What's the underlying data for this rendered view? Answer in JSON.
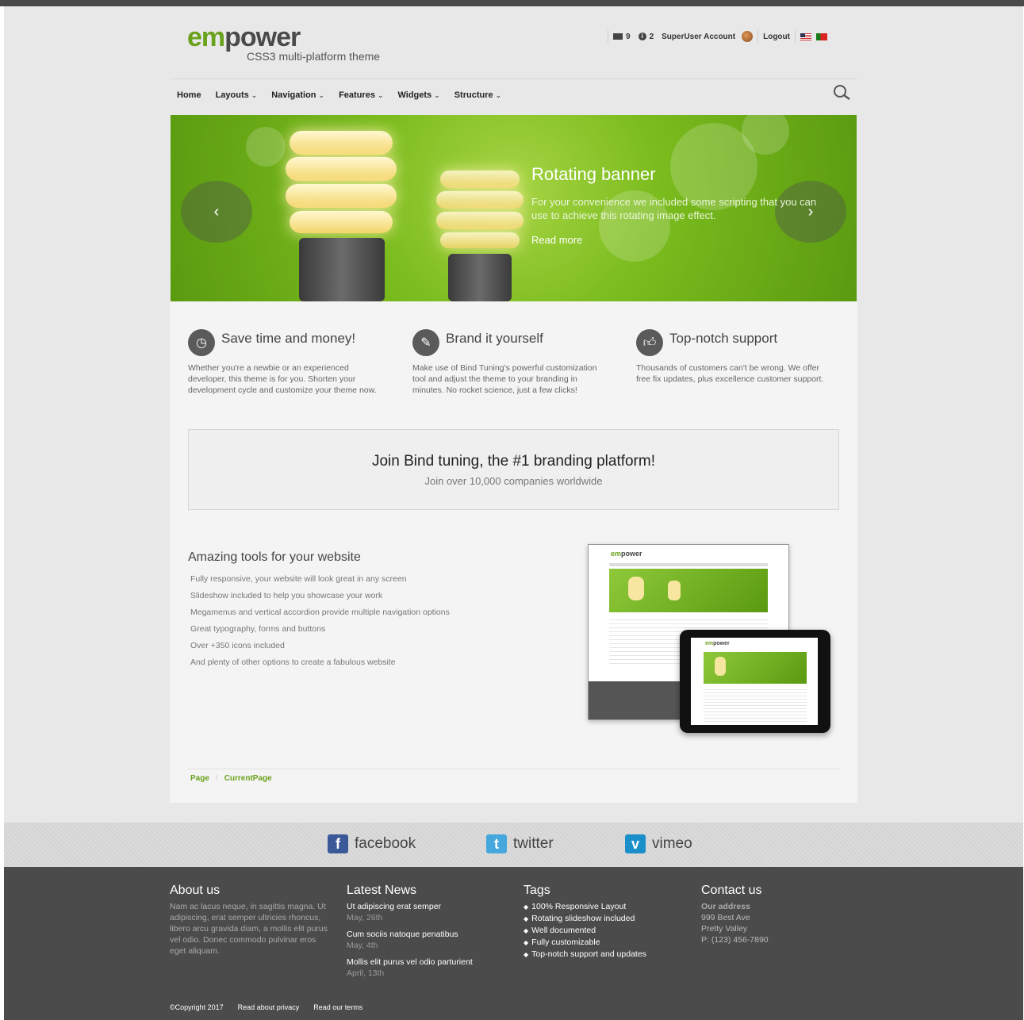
{
  "logo": {
    "part1": "em",
    "part2": "power",
    "tagline": "CSS3 multi-platform theme"
  },
  "userbar": {
    "messages_count": "9",
    "notifications_count": "2",
    "account": "SuperUser Account",
    "logout": "Logout"
  },
  "nav": {
    "items": [
      "Home",
      "Layouts",
      "Navigation",
      "Features",
      "Widgets",
      "Structure"
    ]
  },
  "banner": {
    "title": "Rotating banner",
    "text": "For your convenience we included some scripting that you can use to achieve this rotating image effect.",
    "link": "Read more",
    "prev": "‹",
    "next": "›"
  },
  "features": [
    {
      "icon": "clock-icon",
      "title": "Save time and money!",
      "text": "Whether you're a newbie or an experienced developer, this theme is for you. Shorten your development cycle and customize your theme now."
    },
    {
      "icon": "magic-wand-icon",
      "title": "Brand it yourself",
      "text": "Make use of Bind Tuning's powerful customization tool and adjust the theme to your branding in minutes. No rocket science, just a few clicks!"
    },
    {
      "icon": "thumbs-up-icon",
      "title": "Top-notch support",
      "text": "Thousands of customers can't be wrong. We offer free fix updates, plus excellence customer support."
    }
  ],
  "join": {
    "title": "Join Bind tuning, the #1 branding platform!",
    "subtitle": "Join over 10,000 companies worldwide"
  },
  "tools": {
    "title": "Amazing tools for your website",
    "items": [
      "Fully responsive, your website will look great in any screen",
      "Slideshow included to help you showcase your work",
      "Megamenus and vertical accordion provide multiple navigation options",
      "Great typography, forms and buttons",
      "Over +350 icons included",
      "And plenty of other options to create a fabulous website"
    ]
  },
  "breadcrumb": {
    "page": "Page",
    "current": "CurrentPage"
  },
  "social": {
    "facebook": "facebook",
    "twitter": "twitter",
    "vimeo": "vimeo"
  },
  "footer": {
    "about": {
      "title": "About us",
      "text": "Nam ac lacus neque, in sagittis magna. Ut adipiscing, erat semper ultricies rhoncus, libero arcu gravida diam, a mollis elit purus vel odio. Donec commodo pulvinar eros eget aliquam."
    },
    "news": {
      "title": "Latest News",
      "items": [
        {
          "title": "Ut adipiscing erat semper",
          "date": "May, 26th"
        },
        {
          "title": "Cum sociis natoque penatibus",
          "date": "May, 4th"
        },
        {
          "title": "Mollis elit purus vel odio parturient",
          "date": "April, 13th"
        }
      ]
    },
    "tags": {
      "title": "Tags",
      "items": [
        "100% Responsive Layout",
        "Rotating slideshow included",
        "Well documented",
        "Fully customizable",
        "Top-notch support and updates"
      ]
    },
    "contact": {
      "title": "Contact us",
      "label": "Our address",
      "line1": "999 Best Ave",
      "line2": "Pretty Valley",
      "phone": "P: (123) 456-7890"
    },
    "copyright": "©Copyright 2017",
    "privacy": "Read about privacy",
    "terms": "Read our terms"
  },
  "colors": {
    "accent": "#6aa11c",
    "footer_bg": "#4b4b4b"
  }
}
